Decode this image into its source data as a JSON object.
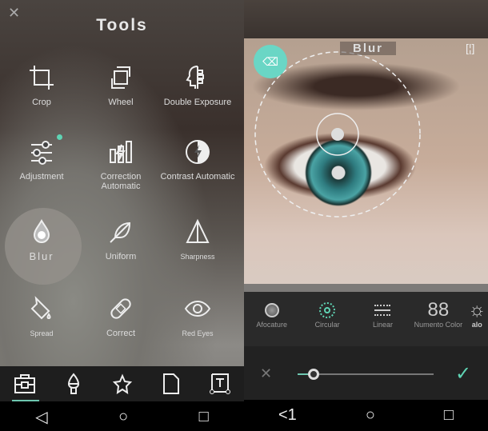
{
  "left": {
    "title": "Tools",
    "tools": [
      {
        "label": "Crop",
        "icon": "crop-icon"
      },
      {
        "label": "Wheel",
        "icon": "rotate-icon"
      },
      {
        "label": "Double Exposure",
        "icon": "double-exposure-icon"
      },
      {
        "label": "Adjustment",
        "icon": "sliders-icon"
      },
      {
        "label": "Correction Automatic",
        "icon": "auto-correction-icon"
      },
      {
        "label": "Contrast Automatic",
        "icon": "contrast-icon"
      },
      {
        "label": "Blur",
        "icon": "drop-icon"
      },
      {
        "label": "Uniform",
        "icon": "feather-icon"
      },
      {
        "label": "Sharpness",
        "icon": "triangle-icon"
      },
      {
        "label": "Spread",
        "icon": "paint-bucket-icon"
      },
      {
        "label": "Correct",
        "icon": "bandage-icon"
      },
      {
        "label": "Red Eyes",
        "icon": "eye-icon"
      }
    ],
    "selected_tool": "Blur",
    "bottom_tabs": [
      "toolbox-icon",
      "brush-icon",
      "sparkle-star-icon",
      "pages-icon",
      "text-frame-icon"
    ],
    "nav": [
      "back",
      "home",
      "recents"
    ]
  },
  "right": {
    "overlay_label": "Blur",
    "modes": [
      {
        "label": "Afocature",
        "icon": "circle-icon"
      },
      {
        "label": "Circular",
        "icon": "circular-icon"
      },
      {
        "label": "Linear",
        "icon": "linear-icon"
      },
      {
        "label": "Numento Color",
        "icon": "88"
      },
      {
        "label": "alo",
        "icon": "sun-icon"
      }
    ],
    "selected_mode": "Circular",
    "slider_value_percent": 12,
    "nav_back_label": "<1"
  },
  "colors": {
    "accent": "#5fd4b4"
  }
}
